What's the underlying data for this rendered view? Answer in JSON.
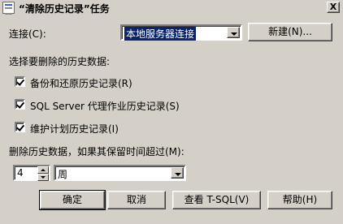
{
  "window": {
    "title": "“清除历史记录”任务",
    "close_glyph": "X"
  },
  "connection": {
    "label": "连接(C):",
    "value": "本地服务器连接",
    "new_button": "新建(N)..."
  },
  "history": {
    "section_label": "选择要删除的历史数据:",
    "options": [
      {
        "label": "备份和还原历史记录(R)",
        "checked": true
      },
      {
        "label": "SQL Server 代理作业历史记录(S)",
        "checked": true
      },
      {
        "label": "维护计划历史记录(I)",
        "checked": true
      }
    ]
  },
  "retention": {
    "label": "删除历史数据，如果其保留时间超过(M):",
    "amount": "4",
    "unit": "周"
  },
  "buttons": {
    "ok": "确定",
    "cancel": "取消",
    "view_tsql": "查看 T-SQL(V)",
    "help": "帮助(H)"
  }
}
